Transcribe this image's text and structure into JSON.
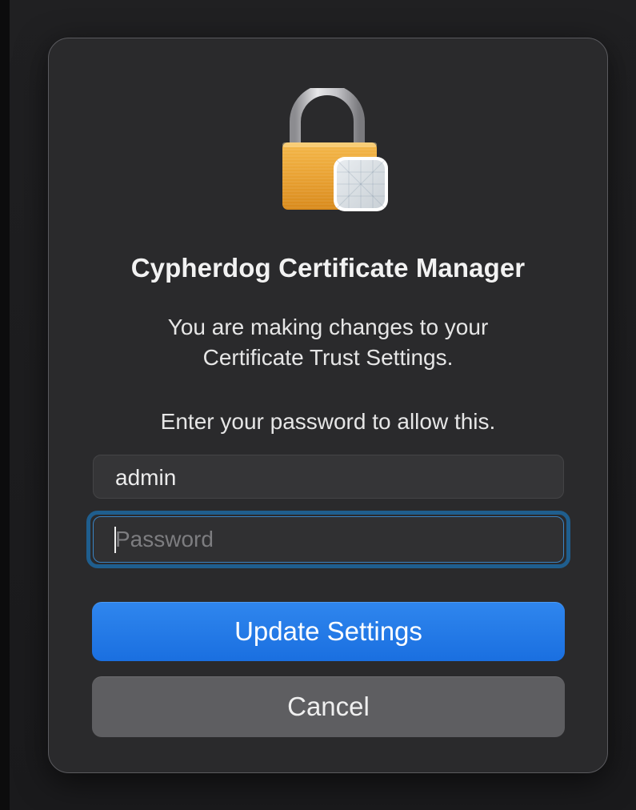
{
  "dialog": {
    "title": "Cypherdog Certificate Manager",
    "message_line1": "You are making changes to your",
    "message_line2": "Certificate Trust Settings.",
    "prompt": "Enter your password to allow this.",
    "icon": "lock-icon"
  },
  "fields": {
    "username_value": "admin",
    "password_placeholder": "Password",
    "password_value": ""
  },
  "buttons": {
    "primary_label": "Update Settings",
    "cancel_label": "Cancel"
  },
  "colors": {
    "accent": "#1a73e8",
    "focus_ring": "#1f5e8e",
    "dialog_bg": "#2a2a2c"
  }
}
